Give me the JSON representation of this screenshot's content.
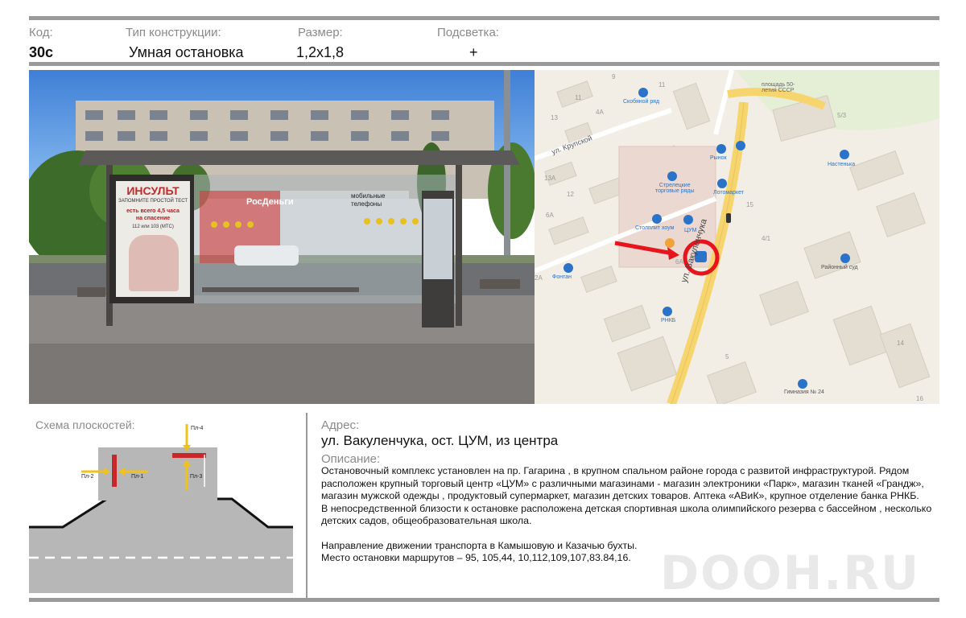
{
  "header": {
    "code_label": "Код:",
    "code_value": "30с",
    "type_label": "Тип конструкции:",
    "type_value": "Умная остановка",
    "size_label": "Размер:",
    "size_value": "1,2х1,8",
    "light_label": "Подсветка:",
    "light_value": "+"
  },
  "photo": {
    "poster_title": "ИНСУЛЬТ",
    "poster_sub": "ЗАПОМНИТЕ ПРОСТОЙ ТЕСТ",
    "poster_line1": "есть всего 4,5 часа",
    "poster_line2": "на спасение",
    "poster_line3": "112 или 103 (МТС)",
    "store_sign": "РосДеньги",
    "glass_sign1": "мобильные",
    "glass_sign2": "телефоны"
  },
  "map": {
    "labels": {
      "street_krupskoy": "ул. Крупской",
      "street_vakulenchuka": "ул. Вакуленчука",
      "square": "площадь 50-\nлетия СССР",
      "skobyanoy": "Скобяной ряд",
      "rynok": "Рынок",
      "nastenka": "Настенька",
      "streletskie": "Стрелецкие\nторговые ряды",
      "lotomarket": "Лотомаркет",
      "stolplit": "Столплит хоум",
      "tsum": "ЦУМ",
      "fontan": "Фонтан",
      "rnkb": "РНКБ",
      "sud": "Районный суд",
      "gimnaziya": "Гимназия № 24"
    },
    "house_numbers": [
      "9",
      "7",
      "11",
      "11",
      "4А",
      "6",
      "13",
      "15",
      "11А",
      "13А",
      "14",
      "12",
      "10",
      "8",
      "6А",
      "5",
      "3",
      "2А",
      "6А",
      "15",
      "5/3",
      "4/1",
      "3",
      "2",
      "10",
      "5",
      "14",
      "16",
      "1",
      "3"
    ]
  },
  "scheme": {
    "title": "Схема плоскостей:",
    "planes": [
      "Пл-1",
      "Пл-2",
      "Пл-3",
      "Пл-4"
    ]
  },
  "address": {
    "label": "Адрес:",
    "value": "ул. Вакуленчука, ост. ЦУМ, из центра",
    "desc_label": "Описание:",
    "paragraphs": [
      "Остановочный комплекс установлен на пр. Гагарина , в крупном спальном районе города  с развитой инфраструктурой. Рядом расположен  крупный торговый центр «ЦУМ» с различными магазинами -  магазин электроники «Парк», магазин тканей «Грандж», магазин мужской одежды , продуктовый супермаркет, магазин детских товаров. Аптека «АВиК», крупное отделение банка РНКБ.",
      "В непосредственной близости к остановке расположена детская спортивная школа  олимпийского резерва с бассейном , несколько детских садов, общеобразовательная школа.",
      "",
      "Направление движении транспорта в Камышовую и Казачью бухты.",
      "Место остановки маршрутов – 95, 105,44, 10,112,109,107,83.84,16."
    ]
  },
  "watermark": "DOOH.RU",
  "colors": {
    "bar": "#9a9a9a",
    "plane_red": "#c8282a",
    "arrow_yellow": "#f1c21b",
    "map_road": "#f7d56e",
    "marker_red": "#e8141c",
    "icon_blue": "#2a73c9"
  }
}
